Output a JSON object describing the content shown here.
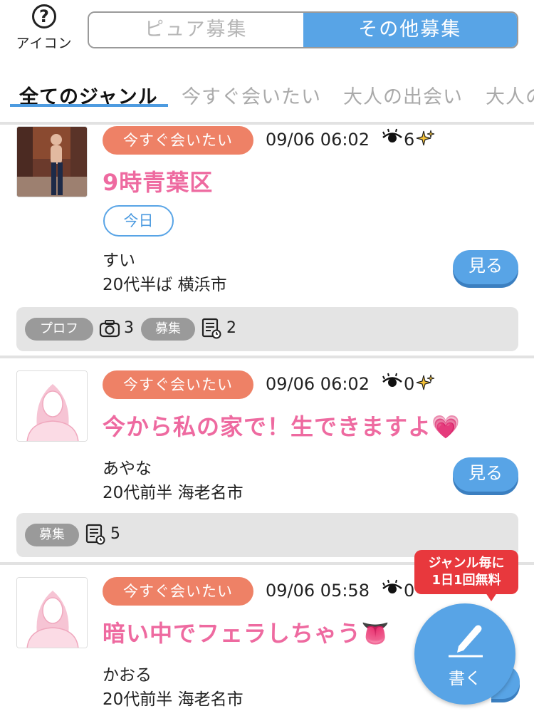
{
  "header": {
    "icon_label": "アイコン",
    "help_symbol": "?",
    "tabs": [
      {
        "label": "ピュア募集",
        "active": false
      },
      {
        "label": "その他募集",
        "active": true
      }
    ]
  },
  "genre_tabs": [
    "全てのジャンル",
    "今すぐ会いたい",
    "大人の出会い",
    "大人の"
  ],
  "posts": [
    {
      "genre": "今すぐ会いたい",
      "time": "09/06 06:02",
      "views": "6",
      "title": "9時青葉区",
      "tag": "今日",
      "name": "すい",
      "meta": "20代半ば 横浜市",
      "view_button": "見る",
      "footer": {
        "prof_label": "プロフ",
        "photo_count": "3",
        "boshu_label": "募集",
        "post_count": "2"
      }
    },
    {
      "genre": "今すぐ会いたい",
      "time": "09/06 06:02",
      "views": "0",
      "title": "今から私の家で！生できますよ",
      "title_emoji": "💗",
      "name": "あやな",
      "meta": "20代前半 海老名市",
      "view_button": "見る",
      "footer": {
        "boshu_label": "募集",
        "post_count": "5"
      }
    },
    {
      "genre": "今すぐ会いたい",
      "time": "09/06 05:58",
      "views": "0",
      "title": "暗い中でフェラしちゃう",
      "title_emoji": "👅",
      "name": "かおる",
      "meta": "20代前半 海老名市"
    }
  ],
  "fab": {
    "bubble_line1": "ジャンル毎に",
    "bubble_line2": "1日1回無料",
    "label": "書く"
  },
  "colors": {
    "accent_blue": "#58a4e6",
    "genre_badge": "#ee8166",
    "title_pink": "#ee6aa0",
    "bubble_red": "#e8383d"
  },
  "icons": [
    "help-icon",
    "eye-icon",
    "sparkle-icon",
    "camera-icon",
    "post-list-icon",
    "pen-icon"
  ]
}
